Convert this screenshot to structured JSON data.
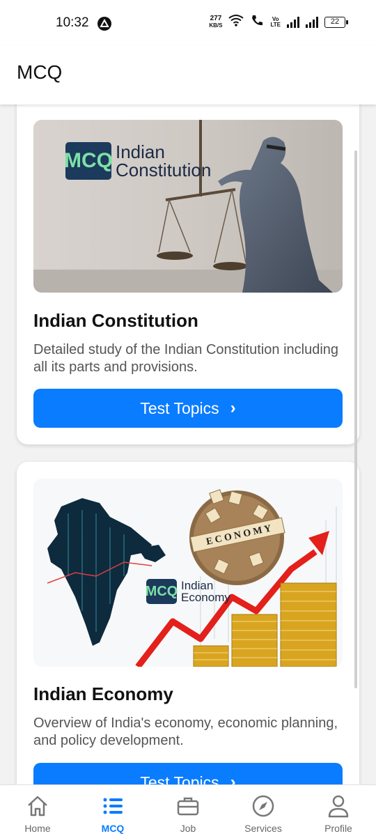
{
  "status_bar": {
    "time": "10:32",
    "net_speed_value": "277",
    "net_speed_unit": "KB/S",
    "volte_top": "Vo",
    "volte_bottom": "LTE",
    "battery": "22"
  },
  "app_bar": {
    "title": "MCQ"
  },
  "cards": [
    {
      "logo_badge": "MCQ",
      "logo_line1": "Indian",
      "logo_line2": "Constitution",
      "title": "Indian Constitution",
      "description": "Detailed study of the Indian Constitution including all its parts and provisions.",
      "button_label": "Test Topics"
    },
    {
      "logo_badge": "MCQ",
      "logo_line1": "Indian",
      "logo_line2": "Economy",
      "tiles_text": "E C O N O M Y",
      "title": "Indian Economy",
      "description": "Overview of India's economy, economic planning, and policy development.",
      "button_label": "Test Topics"
    }
  ],
  "bottom_nav": [
    {
      "label": "Home",
      "icon": "home-icon",
      "active": false
    },
    {
      "label": "MCQ",
      "icon": "list-icon",
      "active": true
    },
    {
      "label": "Job",
      "icon": "briefcase-icon",
      "active": false
    },
    {
      "label": "Services",
      "icon": "compass-icon",
      "active": false
    },
    {
      "label": "Profile",
      "icon": "person-icon",
      "active": false
    }
  ],
  "colors": {
    "accent": "#0a7cff",
    "text": "#111111",
    "muted": "#555555"
  }
}
